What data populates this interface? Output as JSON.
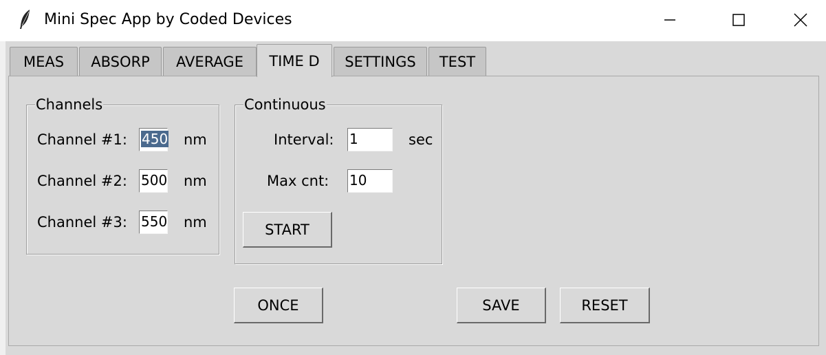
{
  "window": {
    "title": "Mini Spec App by Coded Devices",
    "icon": "feather-icon",
    "controls": [
      "minimize-icon",
      "maximize-icon",
      "close-icon"
    ]
  },
  "tabs": [
    {
      "label": "MEAS",
      "active": false
    },
    {
      "label": "ABSORP",
      "active": false
    },
    {
      "label": "AVERAGE",
      "active": false
    },
    {
      "label": "TIME D",
      "active": true
    },
    {
      "label": "SETTINGS",
      "active": false
    },
    {
      "label": "TEST",
      "active": false
    }
  ],
  "channels": {
    "title": "Channels",
    "unit": "nm",
    "items": [
      {
        "label": "Channel #1:",
        "value": "450",
        "selected": true
      },
      {
        "label": "Channel #2:",
        "value": "500",
        "selected": false
      },
      {
        "label": "Channel #3:",
        "value": "550",
        "selected": false
      }
    ]
  },
  "continuous": {
    "title": "Continuous",
    "interval_label": "Interval:",
    "interval_value": "1",
    "interval_unit": "sec",
    "maxcnt_label": "Max cnt:",
    "maxcnt_value": "10",
    "start_label": "START"
  },
  "buttons": {
    "once": "ONCE",
    "save": "SAVE",
    "reset": "RESET"
  },
  "colors": {
    "background": "#d9d9d9",
    "selection": "#4b6a8e"
  }
}
